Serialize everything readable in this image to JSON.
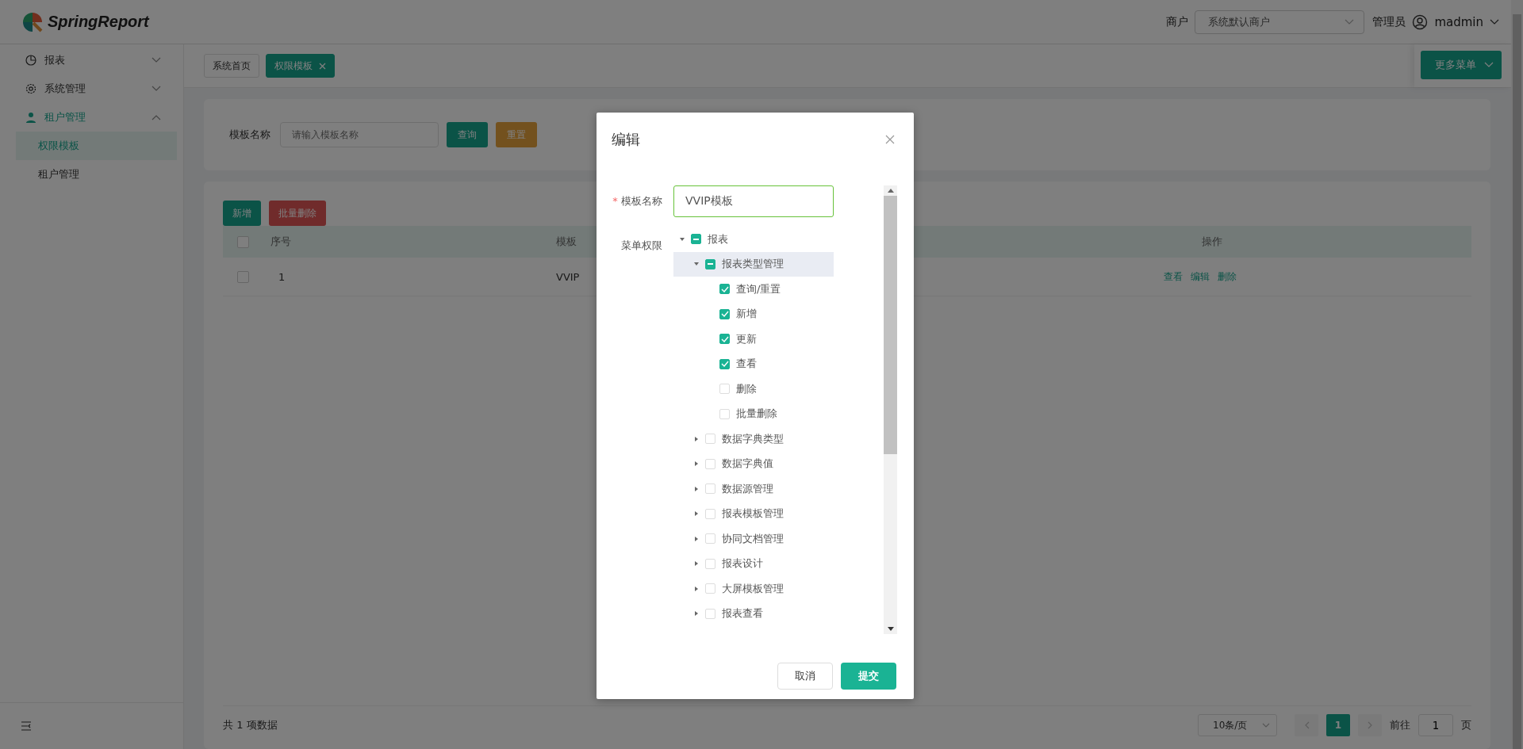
{
  "header": {
    "logo": "SpringReport",
    "merchant_label": "商户",
    "merchant_value": "系统默认商户",
    "role": "管理员",
    "user": "madmin"
  },
  "sidebar": {
    "items": [
      {
        "label": "报表",
        "kind": "chart",
        "expanded": false
      },
      {
        "label": "系统管理",
        "kind": "settings",
        "expanded": false
      },
      {
        "label": "租户管理",
        "kind": "tenant",
        "expanded": true,
        "children": [
          {
            "label": "权限模板",
            "selected": true
          },
          {
            "label": "租户管理",
            "selected": false
          }
        ]
      }
    ]
  },
  "tabs": [
    {
      "label": "系统首页",
      "selected": false,
      "closable": false
    },
    {
      "label": "权限模板",
      "selected": true,
      "closable": true
    }
  ],
  "more_menu": "更多菜单",
  "search": {
    "label": "模板名称",
    "placeholder": "请输入模板名称",
    "buttons": [
      {
        "label": "查询",
        "kind": "primary"
      },
      {
        "label": "重置",
        "kind": "warning"
      }
    ]
  },
  "toolbar": [
    {
      "label": "新增",
      "kind": "primary"
    },
    {
      "label": "批量删除",
      "kind": "danger"
    }
  ],
  "table": {
    "header_checked": false,
    "columns": [
      "序号",
      "模板",
      "操作"
    ],
    "rows": [
      {
        "checked": false,
        "index": "1",
        "name": "VVIP",
        "actions": [
          "查看",
          "编辑",
          "删除"
        ]
      }
    ]
  },
  "footer": {
    "total": "共 1 项数据",
    "page_size": "10条/页",
    "pages": [
      {
        "label": "1",
        "selected": true
      }
    ],
    "goto_label": "前往",
    "goto_value": "1",
    "goto_suffix": "页"
  },
  "dialog": {
    "title": "编辑",
    "name_label": "模板名称",
    "required": true,
    "required_mark": "*",
    "name_value": "VVIP模板",
    "menu_label": "菜单权限",
    "tree": [
      {
        "label": "报表",
        "expanded": true,
        "indeterminate": true,
        "current": false,
        "children": [
          {
            "label": "报表类型管理",
            "expanded": true,
            "indeterminate": true,
            "current": true,
            "children": [
              {
                "label": "查询/重置",
                "checked": true,
                "current": false
              },
              {
                "label": "新增",
                "checked": true,
                "current": false
              },
              {
                "label": "更新",
                "checked": true,
                "current": false
              },
              {
                "label": "查看",
                "checked": true,
                "current": false
              },
              {
                "label": "删除",
                "checked": false,
                "current": false
              },
              {
                "label": "批量删除",
                "checked": false,
                "current": false
              }
            ]
          },
          {
            "label": "数据字典类型",
            "expanded": false,
            "checked": false,
            "current": false
          },
          {
            "label": "数据字典值",
            "expanded": false,
            "checked": false,
            "current": false
          },
          {
            "label": "数据源管理",
            "expanded": false,
            "checked": false,
            "current": false
          },
          {
            "label": "报表模板管理",
            "expanded": false,
            "checked": false,
            "current": false
          },
          {
            "label": "协同文档管理",
            "expanded": false,
            "checked": false,
            "current": false
          },
          {
            "label": "报表设计",
            "expanded": false,
            "checked": false,
            "current": false
          },
          {
            "label": "大屏模板管理",
            "expanded": false,
            "checked": false,
            "current": false
          },
          {
            "label": "报表查看",
            "expanded": false,
            "checked": false,
            "current": false
          }
        ]
      }
    ],
    "buttons": [
      {
        "label": "取消",
        "kind": "default"
      },
      {
        "label": "提交",
        "kind": "primary"
      }
    ]
  }
}
